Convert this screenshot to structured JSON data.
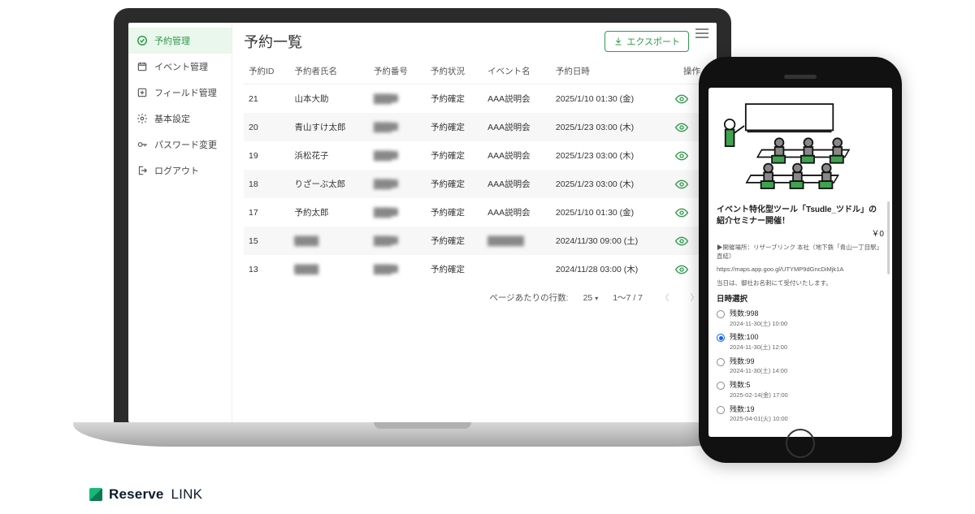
{
  "sidebar": {
    "items": [
      {
        "label": "予約管理",
        "icon": "check-circle"
      },
      {
        "label": "イベント管理",
        "icon": "calendar"
      },
      {
        "label": "フィールド管理",
        "icon": "plus-box"
      },
      {
        "label": "基本設定",
        "icon": "gear"
      },
      {
        "label": "パスワード変更",
        "icon": "key"
      },
      {
        "label": "ログアウト",
        "icon": "logout"
      }
    ]
  },
  "page": {
    "title": "予約一覧",
    "export_label": "エクスポート"
  },
  "table": {
    "headers": {
      "id": "予約ID",
      "name": "予約者氏名",
      "number": "予約番号",
      "status": "予約状況",
      "event": "イベント名",
      "datetime": "予約日時",
      "action": "操作"
    },
    "rows": [
      {
        "id": "21",
        "name": "山本大助",
        "number": "████",
        "status": "予約確定",
        "event": "AAA説明会",
        "datetime": "2025/1/10 01:30 (金)"
      },
      {
        "id": "20",
        "name": "青山すけ太郎",
        "number": "████",
        "status": "予約確定",
        "event": "AAA説明会",
        "datetime": "2025/1/23 03:00 (木)"
      },
      {
        "id": "19",
        "name": "浜松花子",
        "number": "████",
        "status": "予約確定",
        "event": "AAA説明会",
        "datetime": "2025/1/23 03:00 (木)"
      },
      {
        "id": "18",
        "name": "りざーぶ太郎",
        "number": "████",
        "status": "予約確定",
        "event": "AAA説明会",
        "datetime": "2025/1/23 03:00 (木)"
      },
      {
        "id": "17",
        "name": "予約太郎",
        "number": "████",
        "status": "予約確定",
        "event": "AAA説明会",
        "datetime": "2025/1/10 01:30 (金)"
      },
      {
        "id": "15",
        "name": "████",
        "number": "████",
        "status": "予約確定",
        "event": "██████",
        "datetime": "2024/11/30 09:00 (土)"
      },
      {
        "id": "13",
        "name": "████",
        "number": "████",
        "status": "予約確定",
        "event": "",
        "datetime": "2024/11/28 03:00 (木)"
      }
    ]
  },
  "pager": {
    "rows_label": "ページあたりの行数:",
    "page_size": "25",
    "range": "1〜7 / 7"
  },
  "phone": {
    "title": "イベント特化型ツール「Tsudle_ツドル」の紹介セミナー開催！",
    "price": "￥0",
    "venue_label": "▶開催場所：リザーブリンク 本社（地下鉄「青山一丁目駅」直結）",
    "map_url": "https://maps.app.goo.gl/UTYMP9dGncDiMjk1A",
    "note": "当日は、御社お名刺にて受付いたします。",
    "select_heading": "日時選択",
    "slots": [
      {
        "label": "残数:998",
        "sub": "2024-11-30(土) 10:00",
        "selected": false
      },
      {
        "label": "残数:100",
        "sub": "2024-11-30(土) 12:00",
        "selected": true
      },
      {
        "label": "残数:99",
        "sub": "2024-11-30(土) 14:00",
        "selected": false
      },
      {
        "label": "残数:5",
        "sub": "2025-02-14(金) 17:00",
        "selected": false
      },
      {
        "label": "残数:19",
        "sub": "2025-04-01(火) 10:00",
        "selected": false
      }
    ]
  },
  "brand": {
    "text1": "Reserve",
    "text2": "LINK"
  }
}
